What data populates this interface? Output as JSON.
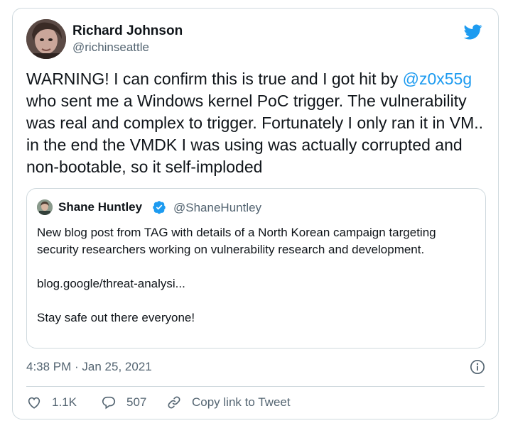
{
  "author": {
    "name": "Richard Johnson",
    "handle": "@richinseattle"
  },
  "tweet": {
    "text_before": "WARNING! I can confirm this is true and I got hit by ",
    "mention": "@z0x55g",
    "text_after": " who sent me a Windows kernel PoC trigger. The vulnerability was real and complex to trigger. Fortunately I only ran it in VM.. in the end the VMDK I was using was actually corrupted and non-bootable, so it self-imploded"
  },
  "quoted_tweet": {
    "name": "Shane Huntley",
    "handle": "@ShaneHuntley",
    "verified": true,
    "paragraphs": [
      "New blog post from TAG with details of a North Korean campaign targeting security researchers working on vulnerability research and development.",
      "blog.google/threat-analysi...",
      "Stay safe out there everyone!"
    ]
  },
  "meta": {
    "timestamp": "4:38 PM · Jan 25, 2021"
  },
  "actions": {
    "like_count": "1.1K",
    "reply_count": "507",
    "copy_label": "Copy link to Tweet"
  },
  "icons": [
    "twitter-bird-icon",
    "verified-badge-icon",
    "info-icon",
    "heart-icon",
    "reply-icon",
    "link-icon"
  ],
  "colors": {
    "accent": "#1d9bf0",
    "text": "#0f1419",
    "secondary": "#536471",
    "border": "#cfd9de"
  }
}
